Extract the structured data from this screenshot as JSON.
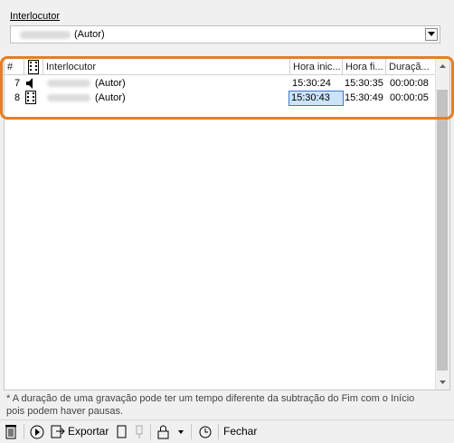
{
  "header": {
    "interlocutor_label": "Interlocutor"
  },
  "combo": {
    "value_suffix": "(Autor)"
  },
  "table": {
    "columns": [
      "#",
      "Interlocutor",
      "Hora inic...",
      "Hora fi...",
      "Duraçã..."
    ],
    "rows": [
      {
        "num": "7",
        "type_icon": "speaker-icon",
        "interlocutor": "(Autor)",
        "start": "15:30:24",
        "end": "15:30:35",
        "duration": "00:00:08"
      },
      {
        "num": "8",
        "type_icon": "film-icon",
        "interlocutor": "(Autor)",
        "start": "15:30:43",
        "end": "15:30:49",
        "duration": "00:00:05"
      }
    ],
    "selected_cell": "rows.1.start"
  },
  "footer": {
    "note_line1": "* A duração de uma gravação pode ter um tempo diferente da subtração do Fim com o Início",
    "note_line2": "pois podem haver pausas."
  },
  "toolbar": {
    "export_label": "Exportar",
    "close_label": "Fechar"
  },
  "colors": {
    "highlight": "#e67e22",
    "selection": "#cce4f7"
  }
}
